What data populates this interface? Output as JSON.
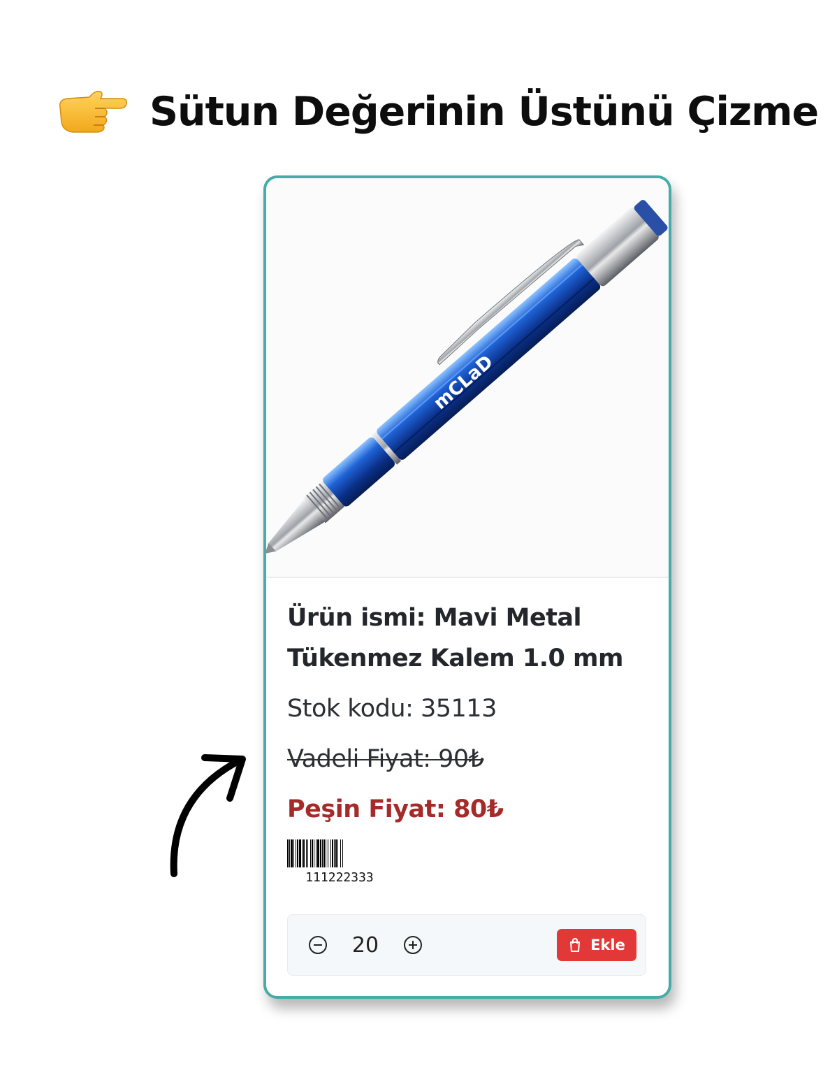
{
  "header": {
    "icon": "pointing-hand-icon",
    "title": "Sütun Değerinin Üstünü Çizme"
  },
  "card": {
    "border_color": "#47aca7",
    "image": {
      "icon": "blue-pen-image",
      "brand_text": "mCLaD"
    },
    "product_name": "Ürün ismi: Mavi Metal Tükenmez Kalem 1.0 mm",
    "stock_code": "Stok kodu: 35113",
    "term_price": "Vadeli Fiyat: 90₺",
    "cash_price": "Peşin Fiyat: 80₺",
    "cash_price_color": "#a52a2a",
    "barcode": {
      "number": "111222333"
    },
    "quantity": {
      "value": "20",
      "minus_icon": "minus-circle-icon",
      "plus_icon": "plus-circle-icon"
    },
    "add_button": {
      "label": "Ekle",
      "icon": "shopping-bag-icon",
      "color": "#e23838"
    }
  },
  "annotation": {
    "icon": "curved-arrow-icon"
  }
}
